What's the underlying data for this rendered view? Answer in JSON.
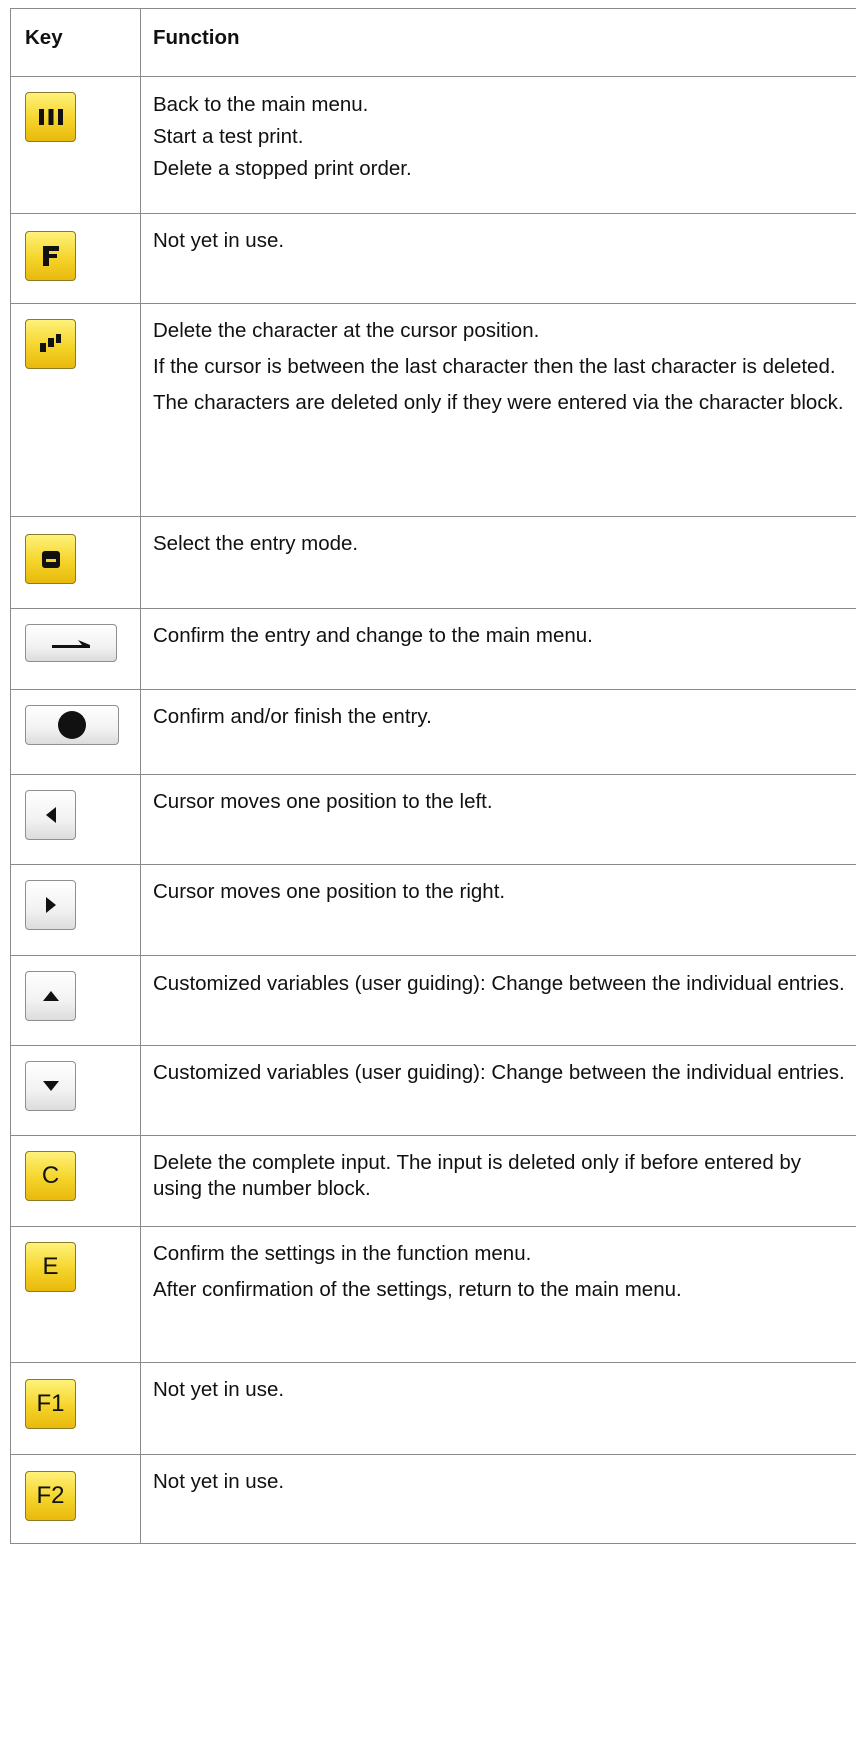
{
  "header": {
    "key": "Key",
    "function": "Function"
  },
  "rows": [
    {
      "icon": "three-bars-icon",
      "lines": [
        "Back to the main menu.",
        "Start a test print.",
        "Delete a stopped print order."
      ]
    },
    {
      "icon": "f-letter-icon",
      "lines": [
        "Not yet in use."
      ]
    },
    {
      "icon": "backspace-blocks-icon",
      "lines": [
        "Delete the character at the cursor position.",
        "If the cursor is between the last character then the last character is deleted.",
        "The characters are deleted only if they were entered via the character block."
      ]
    },
    {
      "icon": "entry-mode-icon",
      "lines": [
        "Select the entry mode."
      ]
    },
    {
      "icon": "enter-icon",
      "lines": [
        "Confirm the entry and change to the main menu."
      ]
    },
    {
      "icon": "circle-icon",
      "lines": [
        "Confirm and/or finish the entry."
      ]
    },
    {
      "icon": "arrow-left-icon",
      "lines": [
        "Cursor moves one position to the left."
      ]
    },
    {
      "icon": "arrow-right-icon",
      "lines": [
        "Cursor moves one position to the right."
      ]
    },
    {
      "icon": "arrow-up-icon",
      "lines": [
        "Customized variables (user guiding): Change between the individual entries."
      ]
    },
    {
      "icon": "arrow-down-icon",
      "lines": [
        "Customized variables (user guiding): Change between the individual entries."
      ]
    },
    {
      "icon": "c-key-icon",
      "key_label": "C",
      "lines": [
        "Delete the complete input. The input is deleted only if before entered by using the number block."
      ]
    },
    {
      "icon": "e-key-icon",
      "key_label": "E",
      "lines": [
        "Confirm the settings in the function menu.",
        "After confirmation of the settings, return to the main menu."
      ]
    },
    {
      "icon": "f1-key-icon",
      "key_label": "F1",
      "lines": [
        "Not yet in use."
      ]
    },
    {
      "icon": "f2-key-icon",
      "key_label": "F2",
      "lines": [
        "Not yet in use."
      ]
    }
  ]
}
